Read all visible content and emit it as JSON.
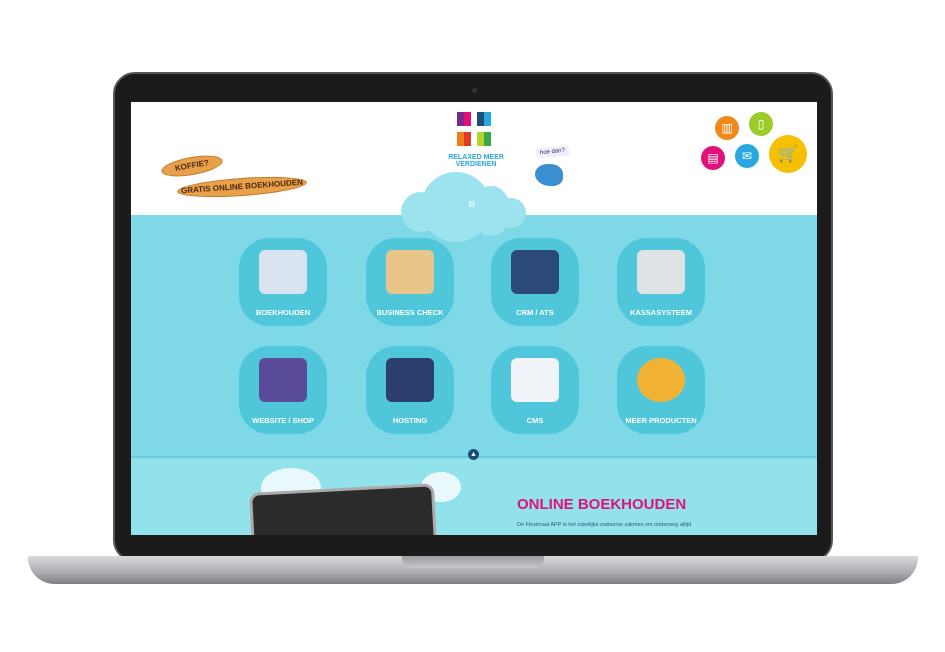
{
  "header": {
    "tagline": "RELAXED MEER VERDIENEN",
    "plank1": "KOFFIE?",
    "plank2": "GRATIS ONLINE BOEKHOUDEN",
    "speech": "hoe dan?",
    "menu_icon": "hamburger-icon",
    "contact_icons": [
      "building-icon",
      "phone-icon",
      "document-icon",
      "mail-icon",
      "cart-icon"
    ]
  },
  "tiles": [
    {
      "label": "BOEKHOUDEN",
      "color": "#d9e4f0"
    },
    {
      "label": "BUSINESS CHECK",
      "color": "#e8c68a"
    },
    {
      "label": "CRM / ATS",
      "color": "#2b4a7a"
    },
    {
      "label": "KASSASYSTEEM",
      "color": "#dfe3e6"
    },
    {
      "label": "WEBSITE / SHOP",
      "color": "#5a4a9a"
    },
    {
      "label": "HOSTING",
      "color": "#2c3e6e"
    },
    {
      "label": "CMS",
      "color": "#f0f4f8"
    },
    {
      "label": "MEER PRODUCTEN",
      "color": "#f2b233"
    }
  ],
  "section": {
    "title": "ONLINE BOEKHOUDEN",
    "text": "De Fleximaal APP is het zakelijke zwitserse zakmes om onderweg altijd"
  },
  "colors": {
    "accent": "#e0127a",
    "tile": "#4fc6da",
    "background": "#7fd8e6"
  }
}
